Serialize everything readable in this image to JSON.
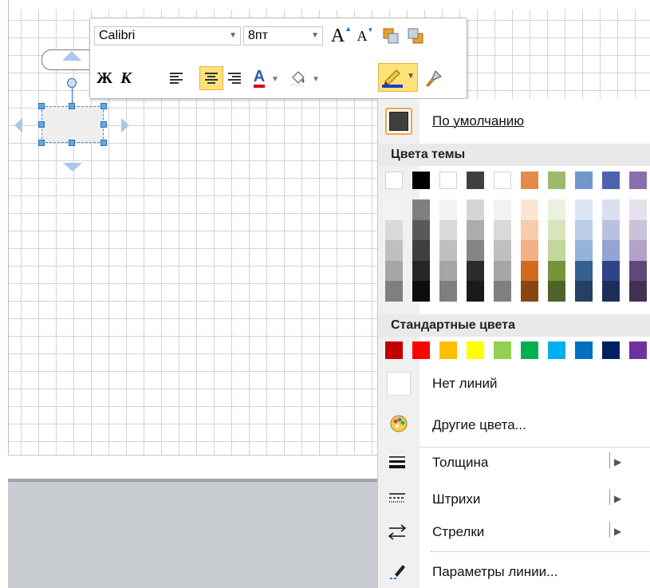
{
  "toolbar": {
    "font_name": "Calibri",
    "font_size": "8пт",
    "grow_font_glyph": "A",
    "shrink_font_glyph": "A",
    "bold_glyph": "Ж",
    "italic_glyph": "К",
    "font_color_glyph": "A",
    "active_button": "align-center"
  },
  "panel": {
    "default_label": "По умолчанию",
    "theme_colors_header": "Цвета темы",
    "standard_colors_header": "Стандартные цвета",
    "no_lines_label": "Нет линий",
    "more_colors_label": "Другие цвета...",
    "weight_label": "Толщина",
    "dashes_label": "Штрихи",
    "arrows_label": "Стрелки",
    "line_options_label": "Параметры линии..."
  },
  "colors": {
    "theme_top": [
      "#ffffff",
      "#000000",
      "#ffffff",
      "#404040",
      "#ffffff",
      "#e58a4a",
      "#9fba6b",
      "#6f98c8",
      "#4c62ac",
      "#8a6fae"
    ],
    "theme_shades": [
      [
        "#f2f2f2",
        "#d9d9d9",
        "#bfbfbf",
        "#a6a6a6",
        "#7f7f7f"
      ],
      [
        "#7f7f7f",
        "#595959",
        "#404040",
        "#262626",
        "#0d0d0d"
      ],
      [
        "#f2f2f2",
        "#d9d9d9",
        "#bfbfbf",
        "#a6a6a6",
        "#7f7f7f"
      ],
      [
        "#d6d6d6",
        "#adadad",
        "#858585",
        "#2b2b2b",
        "#1a1a1a"
      ],
      [
        "#f2f2f2",
        "#d9d9d9",
        "#bfbfbf",
        "#a6a6a6",
        "#7f7f7f"
      ],
      [
        "#fbe5d6",
        "#f7cbac",
        "#f3b083",
        "#d06a1e",
        "#8a4612"
      ],
      [
        "#ebf1de",
        "#d7e4bd",
        "#c3d69b",
        "#77933c",
        "#4f6228"
      ],
      [
        "#dce6f2",
        "#b9cde5",
        "#95b3d7",
        "#366092",
        "#244062"
      ],
      [
        "#dbe0f0",
        "#b8c1e0",
        "#94a3d1",
        "#2f4388",
        "#1f2d5b"
      ],
      [
        "#e6e0ec",
        "#ccc1da",
        "#b3a2c7",
        "#60497a",
        "#403151"
      ]
    ],
    "standard": [
      "#c00000",
      "#ff0000",
      "#ffc000",
      "#ffff00",
      "#92d050",
      "#00b050",
      "#00b0f0",
      "#0070c0",
      "#002060",
      "#7030a0"
    ],
    "default_swatch": "#404040",
    "accent_highlight": "#fde27a"
  }
}
